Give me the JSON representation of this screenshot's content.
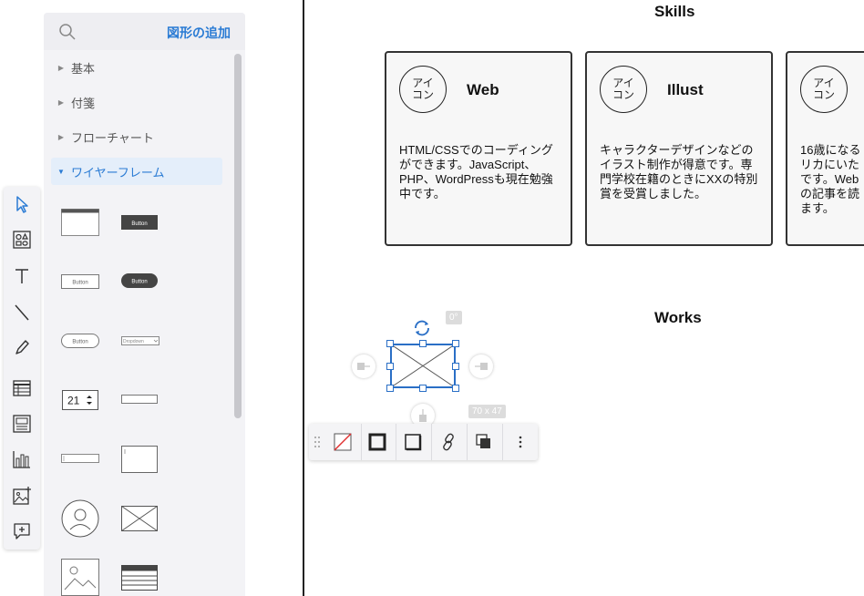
{
  "panel": {
    "title": "図形の追加",
    "categories": [
      {
        "label": "基本",
        "expanded": false
      },
      {
        "label": "付箋",
        "expanded": false
      },
      {
        "label": "フローチャート",
        "expanded": false
      },
      {
        "label": "ワイヤーフレーム",
        "expanded": true
      }
    ],
    "thumbnails": {
      "button_label": "Button",
      "dropdown_label": "Dropdown",
      "stepper_value": "21"
    }
  },
  "toolbar": {
    "tools": [
      "select-icon",
      "shapes-icon",
      "text-icon",
      "line-icon",
      "pen-icon",
      "table-icon",
      "frame-icon",
      "chart-icon",
      "image-icon",
      "comment-icon"
    ]
  },
  "canvas": {
    "skills_heading": "Skills",
    "works_heading": "Works",
    "cards": [
      {
        "icon": "アイ\nコン",
        "title": "Web",
        "text": "HTML/CSSでのコーディングができます。JavaScript、PHP、WordPressも現在勉強中です。"
      },
      {
        "icon": "アイ\nコン",
        "title": "Illust",
        "text": "キャラクターデザインなどのイラスト制作が得意です。専門学校在籍のときにXXの特別賞を受賞しました。"
      },
      {
        "icon": "アイ\nコン",
        "title": "",
        "text": "16歳になるリカにいたです。Webの記事を読ます。"
      }
    ]
  },
  "selection": {
    "rotation": "0°",
    "size": "70 x 47"
  },
  "colors": {
    "accent": "#2a7bd4",
    "selection": "#2a6fc6"
  }
}
